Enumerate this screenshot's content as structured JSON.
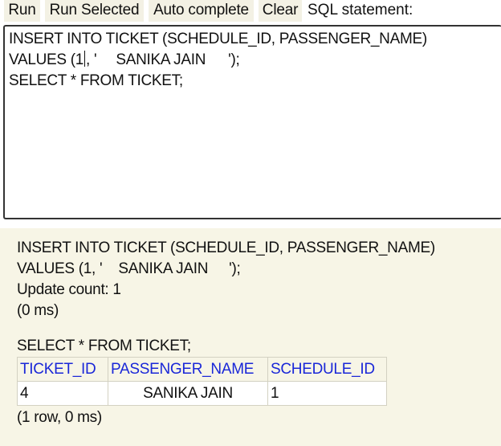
{
  "toolbar": {
    "run": "Run",
    "run_selected": "Run Selected",
    "auto_complete": "Auto complete",
    "clear": "Clear",
    "statement_label": "SQL statement:"
  },
  "editor": {
    "line1": "INSERT INTO TICKET (SCHEDULE_ID, PASSENGER_NAME)",
    "line2_a": "VALUES (1",
    "line2_b": ", '",
    "line2_name": "SANIKA JAIN",
    "line2_c": "');",
    "line3": "SELECT * FROM TICKET;"
  },
  "result": {
    "stmt1_line1": "INSERT INTO TICKET (SCHEDULE_ID, PASSENGER_NAME)",
    "stmt1_line2_a": "VALUES (1, '",
    "stmt1_line2_name": "SANIKA JAIN",
    "stmt1_line2_c": "');",
    "update_count": "Update count: 1",
    "timing1": "(0 ms)",
    "stmt2": "SELECT * FROM TICKET;",
    "table": {
      "headers": [
        "TICKET_ID",
        "PASSENGER_NAME",
        "SCHEDULE_ID"
      ],
      "rows": [
        [
          "4",
          "SANIKA JAIN",
          "1"
        ]
      ]
    },
    "timing2": "(1 row, 0 ms)"
  },
  "colors": {
    "header_link": "#1a27d8",
    "panel_background": "#f7f5e6",
    "button_background": "#f3f1e4"
  }
}
